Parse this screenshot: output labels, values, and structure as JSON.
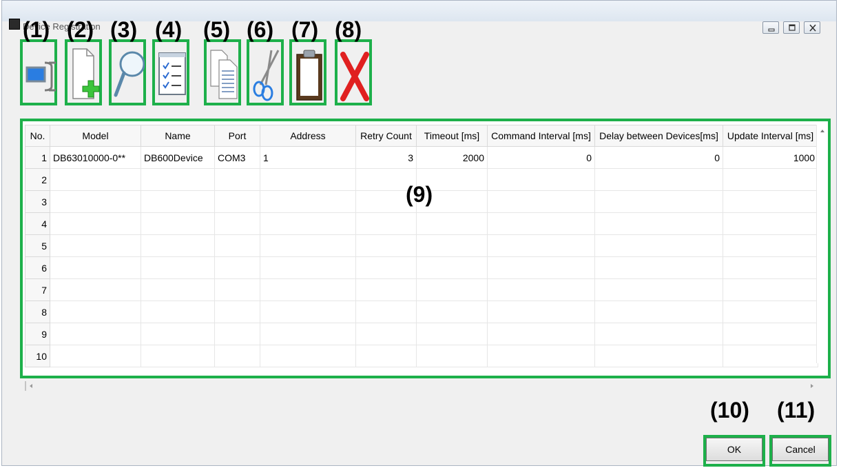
{
  "window": {
    "title": "Device Registration",
    "controls": [
      "minimize",
      "maximize",
      "close"
    ]
  },
  "toolbar": {
    "items": [
      {
        "id": "connect",
        "icon": "serial-connection-icon",
        "callout": "(1)"
      },
      {
        "id": "add",
        "icon": "add-device-icon",
        "callout": "(2)"
      },
      {
        "id": "search",
        "icon": "search-icon",
        "callout": "(3)"
      },
      {
        "id": "properties",
        "icon": "checklist-icon",
        "callout": "(4)"
      },
      {
        "id": "copy",
        "icon": "copy-icon",
        "callout": "(5)"
      },
      {
        "id": "cut",
        "icon": "scissors-icon",
        "callout": "(6)"
      },
      {
        "id": "paste",
        "icon": "clipboard-icon",
        "callout": "(7)"
      },
      {
        "id": "delete",
        "icon": "red-x-icon",
        "callout": "(8)"
      }
    ]
  },
  "grid": {
    "callout": "(9)",
    "columns": [
      "No.",
      "Model",
      "Name",
      "Port",
      "Address",
      "Retry Count",
      "Timeout [ms]",
      "Command Interval [ms]",
      "Delay between Devices[ms]",
      "Update Interval [ms]"
    ],
    "rows": [
      [
        "1",
        "DB63010000-0**",
        "DB600Device",
        "COM3",
        "1",
        "3",
        "2000",
        "0",
        "0",
        "1000"
      ],
      [
        "2",
        "",
        "",
        "",
        "",
        "",
        "",
        "",
        "",
        ""
      ],
      [
        "3",
        "",
        "",
        "",
        "",
        "",
        "",
        "",
        "",
        ""
      ],
      [
        "4",
        "",
        "",
        "",
        "",
        "",
        "",
        "",
        "",
        ""
      ],
      [
        "5",
        "",
        "",
        "",
        "",
        "",
        "",
        "",
        "",
        ""
      ],
      [
        "6",
        "",
        "",
        "",
        "",
        "",
        "",
        "",
        "",
        ""
      ],
      [
        "7",
        "",
        "",
        "",
        "",
        "",
        "",
        "",
        "",
        ""
      ],
      [
        "8",
        "",
        "",
        "",
        "",
        "",
        "",
        "",
        "",
        ""
      ],
      [
        "9",
        "",
        "",
        "",
        "",
        "",
        "",
        "",
        "",
        ""
      ],
      [
        "10",
        "",
        "",
        "",
        "",
        "",
        "",
        "",
        "",
        ""
      ]
    ]
  },
  "buttons": {
    "ok": {
      "label": "OK",
      "callout": "(10)"
    },
    "cancel": {
      "label": "Cancel",
      "callout": "(11)"
    }
  },
  "colors": {
    "highlight": "#1db04a"
  }
}
